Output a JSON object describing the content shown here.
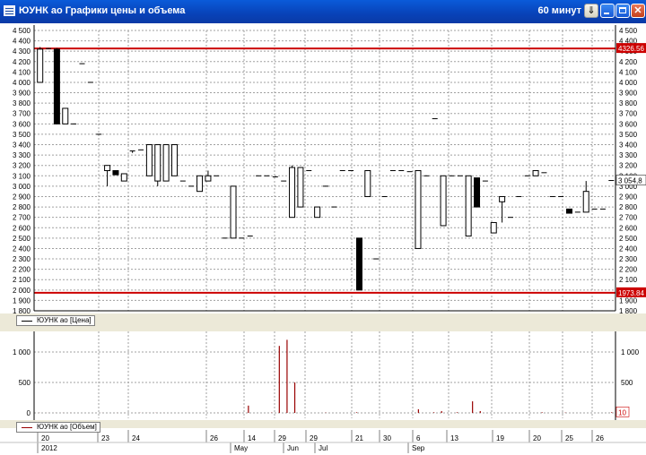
{
  "window": {
    "title": "ЮУНК ао Графики цены и объема",
    "interval": "60 минут",
    "buttons": {
      "download": "⇓",
      "minimize": "",
      "maximize": "",
      "close": "✕"
    }
  },
  "price_panel": {
    "legend": "ЮУНК ао [Цена]",
    "y_ticks": [
      "1 800",
      "1 900",
      "2 000",
      "2 100",
      "2 200",
      "2 300",
      "2 400",
      "2 500",
      "2 600",
      "2 700",
      "2 800",
      "2 900",
      "3 000",
      "3 100",
      "3 200",
      "3 300",
      "3 400",
      "3 500",
      "3 600",
      "3 700",
      "3 800",
      "3 900",
      "4 000",
      "4 100",
      "4 200",
      "4 300",
      "4 400",
      "4 500"
    ],
    "upper_line": {
      "value": 4326.56,
      "label": "4326.56"
    },
    "lower_line": {
      "value": 1973.84,
      "label": "1973.84"
    },
    "last_price": {
      "value": 3054.8,
      "label": "3 054,8"
    },
    "right_tick_label": "3 100",
    "colors": {
      "level_line": "#cc0000",
      "up_candle": "#ffffff",
      "down_candle": "#000000",
      "grid": "#a0a0a0"
    }
  },
  "volume_panel": {
    "legend": "ЮУНК ао [Объем]",
    "y_ticks": [
      "0",
      "500",
      "1 000"
    ],
    "last_volume": "10",
    "colors": {
      "bar": "#990000"
    }
  },
  "x_axis": {
    "top_labels": [
      "20",
      "23",
      "24",
      "26",
      "14",
      "29",
      "29",
      "21",
      "30",
      "6",
      "13",
      "19",
      "20",
      "25",
      "26"
    ],
    "bottom_labels": [
      "2012",
      "May",
      "Jun",
      "Jul",
      "Sep"
    ]
  },
  "chart_data": [
    {
      "type": "candlestick",
      "y_axis": [
        1800,
        4500
      ],
      "grid": true,
      "horizontal_lines": [
        4326.56,
        1973.84
      ],
      "candles": [
        {
          "o": 4000,
          "h": 4340,
          "l": 4000,
          "c": 4320
        },
        {
          "o": 4320,
          "h": 4330,
          "l": 4320,
          "c": 4325
        },
        {
          "o": 4320,
          "h": 4330,
          "l": 3600,
          "c": 3600
        },
        {
          "o": 3600,
          "h": 3750,
          "l": 3600,
          "c": 3750
        },
        {
          "o": 3600,
          "h": 3600,
          "l": 3600,
          "c": 3600
        },
        {
          "o": 4180,
          "h": 4180,
          "l": 4180,
          "c": 4180
        },
        {
          "o": 4000,
          "h": 4000,
          "l": 4000,
          "c": 4000
        },
        {
          "o": 3500,
          "h": 3500,
          "l": 3500,
          "c": 3500
        },
        {
          "o": 3150,
          "h": 3200,
          "l": 3000,
          "c": 3200
        },
        {
          "o": 3150,
          "h": 3150,
          "l": 3110,
          "c": 3110
        },
        {
          "o": 3050,
          "h": 3120,
          "l": 3050,
          "c": 3120
        },
        {
          "o": 3330,
          "h": 3340,
          "l": 3320,
          "c": 3340
        },
        {
          "o": 3350,
          "h": 3350,
          "l": 3350,
          "c": 3350
        },
        {
          "o": 3100,
          "h": 3400,
          "l": 3100,
          "c": 3400
        },
        {
          "o": 3050,
          "h": 3400,
          "l": 3000,
          "c": 3400
        },
        {
          "o": 3050,
          "h": 3400,
          "l": 3050,
          "c": 3400
        },
        {
          "o": 3100,
          "h": 3400,
          "l": 3100,
          "c": 3400
        },
        {
          "o": 3050,
          "h": 3050,
          "l": 3050,
          "c": 3050
        },
        {
          "o": 3000,
          "h": 3000,
          "l": 3000,
          "c": 3000
        },
        {
          "o": 2950,
          "h": 3100,
          "l": 2950,
          "c": 3100
        },
        {
          "o": 3050,
          "h": 3150,
          "l": 3050,
          "c": 3100
        },
        {
          "o": 3100,
          "h": 3100,
          "l": 3100,
          "c": 3100
        },
        {
          "o": 2500,
          "h": 2500,
          "l": 2500,
          "c": 2500
        },
        {
          "o": 2500,
          "h": 3000,
          "l": 2500,
          "c": 3000
        },
        {
          "o": 2500,
          "h": 2500,
          "l": 2500,
          "c": 2500
        },
        {
          "o": 2520,
          "h": 2520,
          "l": 2520,
          "c": 2520
        },
        {
          "o": 3100,
          "h": 3100,
          "l": 3100,
          "c": 3100
        },
        {
          "o": 3100,
          "h": 3100,
          "l": 3100,
          "c": 3100
        },
        {
          "o": 3090,
          "h": 3090,
          "l": 3090,
          "c": 3090
        },
        {
          "o": 3050,
          "h": 3050,
          "l": 3050,
          "c": 3050
        },
        {
          "o": 2700,
          "h": 3200,
          "l": 2700,
          "c": 3180
        },
        {
          "o": 2800,
          "h": 3180,
          "l": 2800,
          "c": 3180
        },
        {
          "o": 3150,
          "h": 3150,
          "l": 3150,
          "c": 3150
        },
        {
          "o": 2700,
          "h": 2800,
          "l": 2700,
          "c": 2800
        },
        {
          "o": 3000,
          "h": 3000,
          "l": 3000,
          "c": 3000
        },
        {
          "o": 2800,
          "h": 2800,
          "l": 2800,
          "c": 2800
        },
        {
          "o": 3150,
          "h": 3150,
          "l": 3150,
          "c": 3150
        },
        {
          "o": 3150,
          "h": 3150,
          "l": 3150,
          "c": 3150
        },
        {
          "o": 2500,
          "h": 2500,
          "l": 2000,
          "c": 2000
        },
        {
          "o": 2900,
          "h": 3150,
          "l": 2900,
          "c": 3150
        },
        {
          "o": 2300,
          "h": 2300,
          "l": 2300,
          "c": 2300
        },
        {
          "o": 2900,
          "h": 2900,
          "l": 2900,
          "c": 2900
        },
        {
          "o": 3150,
          "h": 3150,
          "l": 3150,
          "c": 3150
        },
        {
          "o": 3150,
          "h": 3150,
          "l": 3150,
          "c": 3150
        },
        {
          "o": 3140,
          "h": 3140,
          "l": 3140,
          "c": 3140
        },
        {
          "o": 2400,
          "h": 3150,
          "l": 2400,
          "c": 3150
        },
        {
          "o": 3100,
          "h": 3100,
          "l": 3100,
          "c": 3100
        },
        {
          "o": 3650,
          "h": 3650,
          "l": 3650,
          "c": 3650
        },
        {
          "o": 2620,
          "h": 3100,
          "l": 2620,
          "c": 3100
        },
        {
          "o": 3100,
          "h": 3100,
          "l": 3100,
          "c": 3100
        },
        {
          "o": 3100,
          "h": 3100,
          "l": 3100,
          "c": 3100
        },
        {
          "o": 2520,
          "h": 3100,
          "l": 2520,
          "c": 3100
        },
        {
          "o": 3080,
          "h": 3080,
          "l": 2800,
          "c": 2800
        },
        {
          "o": 3050,
          "h": 3050,
          "l": 3050,
          "c": 3050
        },
        {
          "o": 2550,
          "h": 2650,
          "l": 2550,
          "c": 2650
        },
        {
          "o": 2850,
          "h": 2900,
          "l": 2650,
          "c": 2900
        },
        {
          "o": 2700,
          "h": 2700,
          "l": 2700,
          "c": 2700
        },
        {
          "o": 2900,
          "h": 2900,
          "l": 2900,
          "c": 2900
        },
        {
          "o": 3100,
          "h": 3100,
          "l": 3100,
          "c": 3100
        },
        {
          "o": 3100,
          "h": 3150,
          "l": 3100,
          "c": 3150
        },
        {
          "o": 3130,
          "h": 3130,
          "l": 3130,
          "c": 3130
        },
        {
          "o": 2900,
          "h": 2900,
          "l": 2900,
          "c": 2900
        },
        {
          "o": 2900,
          "h": 2900,
          "l": 2900,
          "c": 2900
        },
        {
          "o": 2780,
          "h": 2780,
          "l": 2740,
          "c": 2740
        },
        {
          "o": 2750,
          "h": 2750,
          "l": 2750,
          "c": 2750
        },
        {
          "o": 2750,
          "h": 3050,
          "l": 2750,
          "c": 2950
        },
        {
          "o": 2780,
          "h": 2780,
          "l": 2780,
          "c": 2780
        },
        {
          "o": 2780,
          "h": 2780,
          "l": 2780,
          "c": 2780
        },
        {
          "o": 3054.8,
          "h": 3054.8,
          "l": 3054.8,
          "c": 3054.8
        }
      ]
    },
    {
      "type": "bar",
      "y_axis": [
        0,
        1250
      ],
      "values": [
        2,
        1,
        1,
        1,
        1,
        0,
        0,
        0,
        1,
        0,
        1,
        1,
        0,
        2,
        1,
        2,
        1,
        0,
        0,
        0,
        0,
        0,
        0,
        1,
        0,
        0,
        0,
        120,
        0,
        0,
        5,
        1100,
        1200,
        500,
        0,
        0,
        0,
        5,
        0,
        0,
        0,
        10,
        0,
        0,
        0,
        0,
        0,
        0,
        0,
        60,
        0,
        10,
        30,
        0,
        10,
        0,
        190,
        30,
        0,
        0,
        0,
        0,
        0,
        0,
        0,
        10,
        0,
        0,
        5,
        0,
        0,
        0,
        0,
        0,
        10
      ]
    }
  ]
}
